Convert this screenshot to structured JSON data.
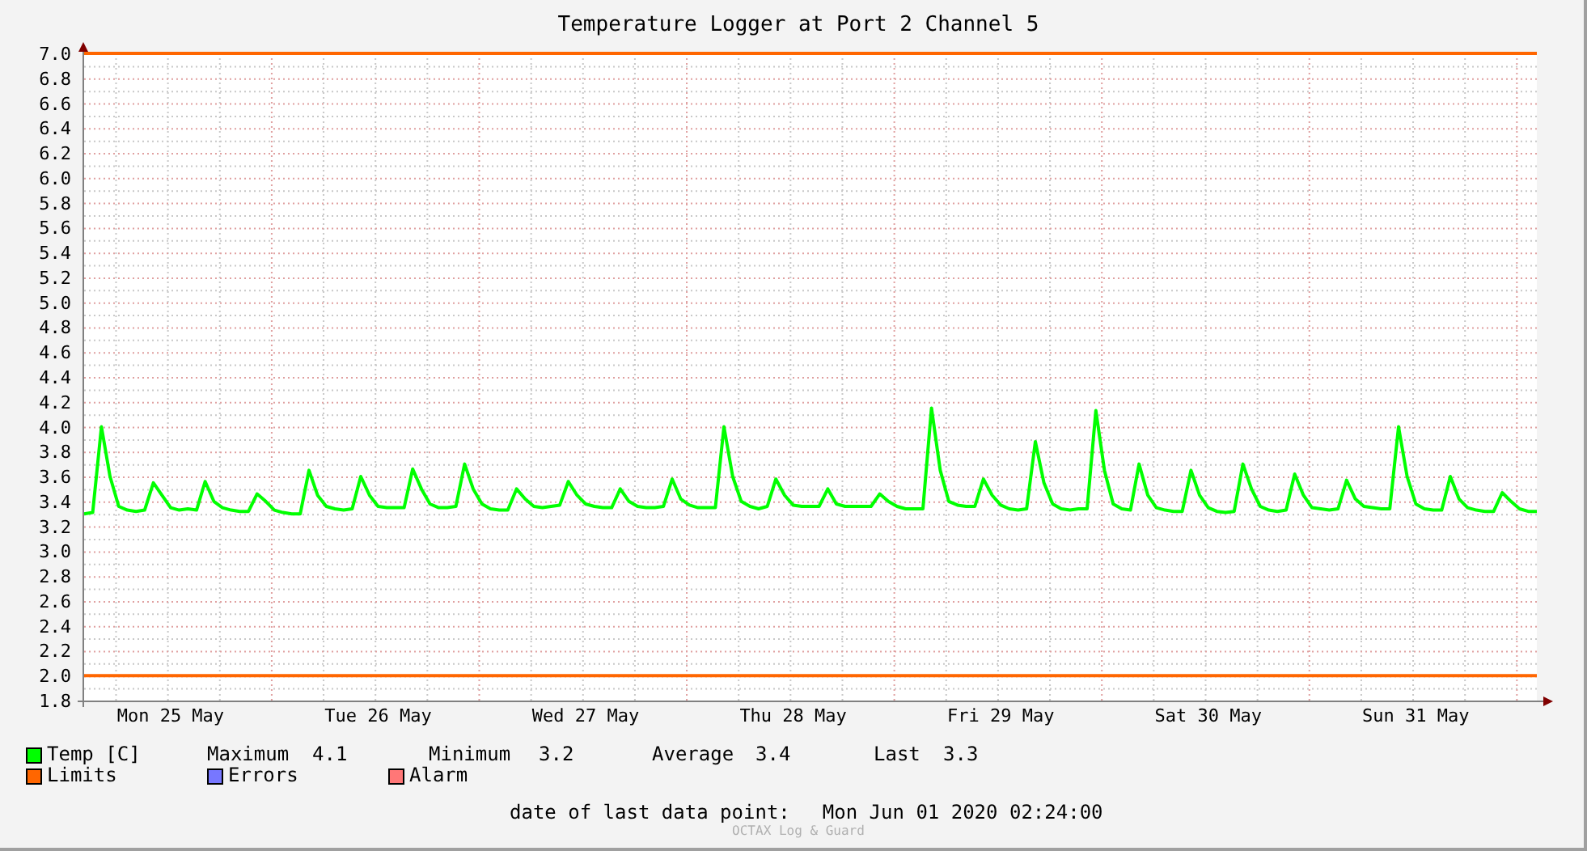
{
  "title": "Temperature Logger at Port 2 Channel 5",
  "chart_data": {
    "type": "line",
    "ylim": [
      1.8,
      7.0
    ],
    "categories": [
      null,
      null,
      null,
      null,
      null,
      null,
      null,
      null,
      null,
      null,
      "Mon 25 May",
      null,
      null,
      null,
      null,
      null,
      null,
      null,
      null,
      null,
      null,
      null,
      null,
      null,
      null,
      null,
      null,
      null,
      null,
      null,
      null,
      null,
      null,
      null,
      "Tue 26 May",
      null,
      null,
      null,
      null,
      null,
      null,
      null,
      null,
      null,
      null,
      null,
      null,
      null,
      null,
      null,
      null,
      null,
      null,
      null,
      null,
      null,
      null,
      null,
      "Wed 27 May",
      null,
      null,
      null,
      null,
      null,
      null,
      null,
      null,
      null,
      null,
      null,
      null,
      null,
      null,
      null,
      null,
      null,
      null,
      null,
      null,
      null,
      null,
      null,
      "Thu 28 May",
      null,
      null,
      null,
      null,
      null,
      null,
      null,
      null,
      null,
      null,
      null,
      null,
      null,
      null,
      null,
      null,
      null,
      null,
      null,
      null,
      null,
      null,
      null,
      "Fri 29 May",
      null,
      null,
      null,
      null,
      null,
      null,
      null,
      null,
      null,
      null,
      null,
      null,
      null,
      null,
      null,
      null,
      null,
      null,
      null,
      null,
      null,
      null,
      null,
      "Sat 30 May",
      null,
      null,
      null,
      null,
      null,
      null,
      null,
      null,
      null,
      null,
      null,
      null,
      null,
      null,
      null,
      null,
      null,
      null,
      null,
      null,
      null,
      null,
      null,
      "Sun 31 May",
      null,
      null,
      null,
      null,
      null,
      null,
      null,
      null,
      null,
      null,
      null,
      null,
      null,
      null
    ],
    "yticks": [
      {
        "value": 7.0,
        "label": "7.0"
      },
      {
        "value": 6.8,
        "label": "6.8"
      },
      {
        "value": 6.6,
        "label": "6.6"
      },
      {
        "value": 6.4,
        "label": "6.4"
      },
      {
        "value": 6.2,
        "label": "6.2"
      },
      {
        "value": 6.0,
        "label": "6.0"
      },
      {
        "value": 5.8,
        "label": "5.8"
      },
      {
        "value": 5.6,
        "label": "5.6"
      },
      {
        "value": 5.4,
        "label": "5.4"
      },
      {
        "value": 5.2,
        "label": "5.2"
      },
      {
        "value": 5.0,
        "label": "5.0"
      },
      {
        "value": 4.8,
        "label": "4.8"
      },
      {
        "value": 4.6,
        "label": "4.6"
      },
      {
        "value": 4.4,
        "label": "4.4"
      },
      {
        "value": 4.2,
        "label": "4.2"
      },
      {
        "value": 4.0,
        "label": "4.0"
      },
      {
        "value": 3.8,
        "label": "3.8"
      },
      {
        "value": 3.6,
        "label": "3.6"
      },
      {
        "value": 3.4,
        "label": "3.4"
      },
      {
        "value": 3.2,
        "label": "3.2"
      },
      {
        "value": 3.0,
        "label": "3.0"
      },
      {
        "value": 2.8,
        "label": "2.8"
      },
      {
        "value": 2.6,
        "label": "2.6"
      },
      {
        "value": 2.4,
        "label": "2.4"
      },
      {
        "value": 2.2,
        "label": "2.2"
      },
      {
        "value": 2.0,
        "label": "2.0"
      },
      {
        "value": 1.8,
        "label": "1.8"
      }
    ],
    "series": [
      {
        "name": "Temp [C]",
        "color": "#00ff00",
        "values": [
          3.3,
          3.31,
          4.0,
          3.6,
          3.36,
          3.33,
          3.32,
          3.33,
          3.55,
          3.45,
          3.35,
          3.33,
          3.34,
          3.33,
          3.56,
          3.4,
          3.35,
          3.33,
          3.32,
          3.32,
          3.46,
          3.4,
          3.33,
          3.31,
          3.3,
          3.3,
          3.65,
          3.45,
          3.36,
          3.34,
          3.33,
          3.34,
          3.6,
          3.45,
          3.36,
          3.35,
          3.35,
          3.35,
          3.66,
          3.5,
          3.38,
          3.35,
          3.35,
          3.36,
          3.7,
          3.5,
          3.38,
          3.34,
          3.33,
          3.33,
          3.5,
          3.42,
          3.36,
          3.35,
          3.36,
          3.37,
          3.56,
          3.45,
          3.38,
          3.36,
          3.35,
          3.35,
          3.5,
          3.4,
          3.36,
          3.35,
          3.35,
          3.36,
          3.58,
          3.42,
          3.37,
          3.35,
          3.35,
          3.35,
          4.0,
          3.6,
          3.4,
          3.36,
          3.34,
          3.36,
          3.58,
          3.45,
          3.37,
          3.36,
          3.36,
          3.36,
          3.5,
          3.38,
          3.36,
          3.36,
          3.36,
          3.36,
          3.46,
          3.4,
          3.36,
          3.34,
          3.34,
          3.34,
          4.15,
          3.65,
          3.4,
          3.37,
          3.36,
          3.36,
          3.58,
          3.45,
          3.37,
          3.34,
          3.33,
          3.34,
          3.88,
          3.55,
          3.38,
          3.34,
          3.33,
          3.34,
          3.34,
          4.13,
          3.65,
          3.38,
          3.34,
          3.33,
          3.7,
          3.45,
          3.35,
          3.33,
          3.32,
          3.32,
          3.65,
          3.45,
          3.35,
          3.32,
          3.31,
          3.32,
          3.7,
          3.5,
          3.36,
          3.33,
          3.32,
          3.33,
          3.62,
          3.45,
          3.35,
          3.34,
          3.33,
          3.34,
          3.57,
          3.42,
          3.36,
          3.35,
          3.34,
          3.34,
          4.0,
          3.6,
          3.38,
          3.34,
          3.33,
          3.33,
          3.6,
          3.42,
          3.35,
          3.33,
          3.32,
          3.32,
          3.47,
          3.4,
          3.34,
          3.32,
          3.32
        ]
      }
    ],
    "grid": true,
    "ref_lines": [
      {
        "axis": "y",
        "value": 7.0,
        "color": "#ff6600"
      },
      {
        "axis": "y",
        "value": 2.0,
        "color": "#ff6600"
      }
    ]
  },
  "legend": [
    {
      "stats": [
        {
          "label": "Maximum",
          "value": "4.1"
        },
        {
          "label": "Minimum",
          "value": "3.2"
        },
        {
          "label": "Average",
          "value": "3.4"
        },
        {
          "label": "Last",
          "value": "3.3"
        }
      ]
    },
    {
      "label": "Limits",
      "color": "#ff6600"
    },
    {
      "label": "Errors",
      "color": "#7777ff"
    },
    {
      "label": "Alarm",
      "color": "#ff7777"
    }
  ],
  "last_data_point": {
    "label": "date of last data point:",
    "value": "Mon Jun 01 2020 02:24:00"
  },
  "watermark": "OCTAX Log & Guard"
}
